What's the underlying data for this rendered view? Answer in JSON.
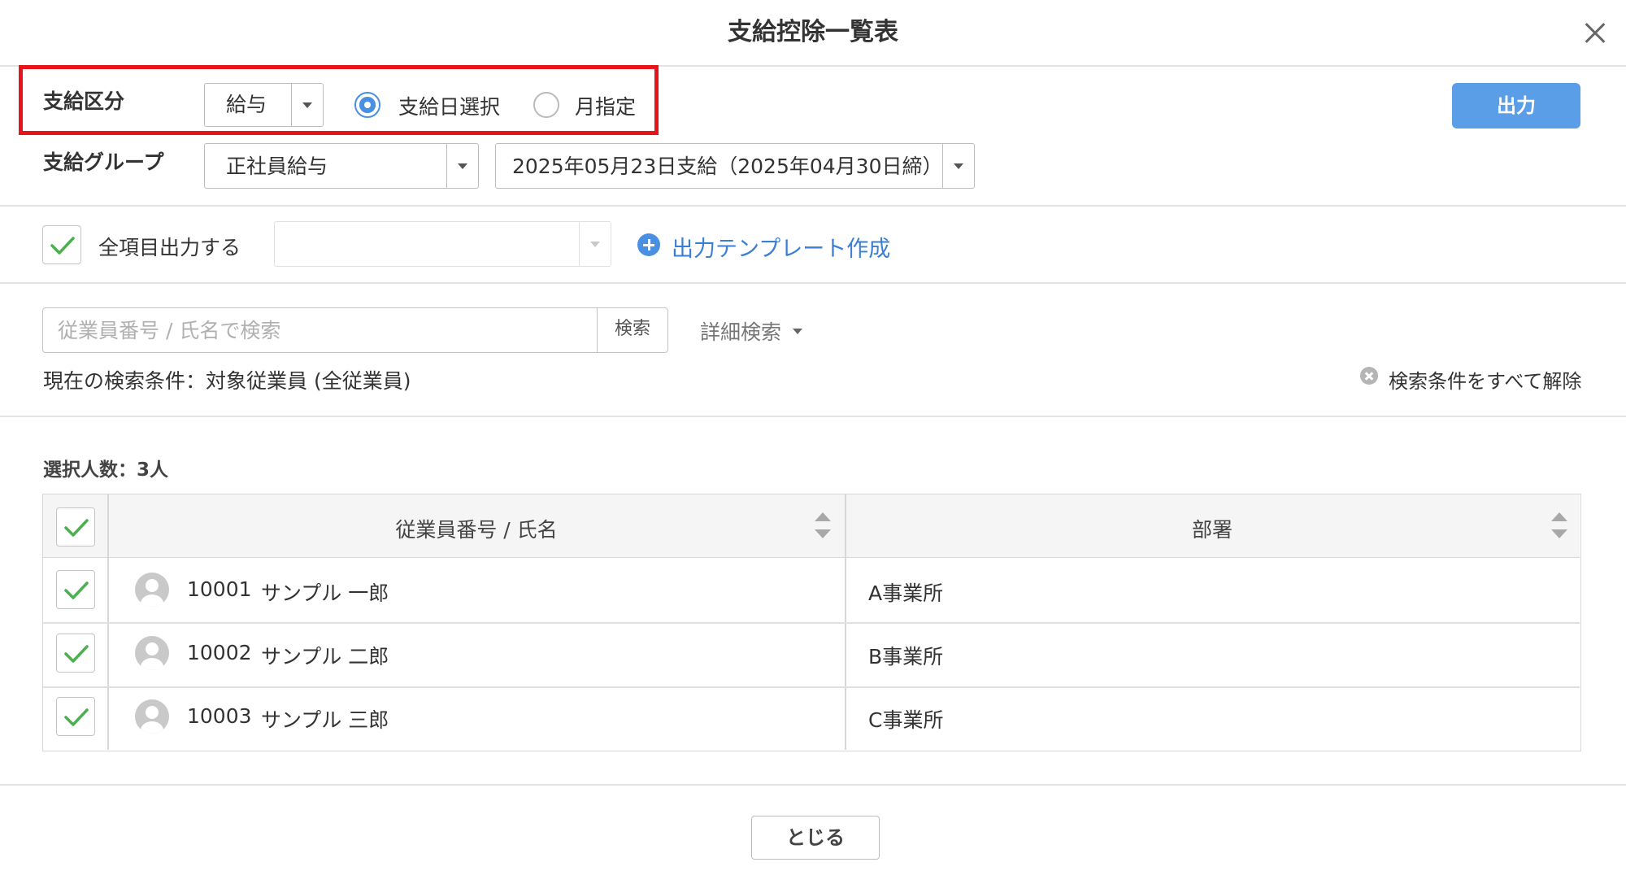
{
  "dialog": {
    "title": "支給控除一覧表"
  },
  "pay_category": {
    "label": "支給区分",
    "select_value": "給与",
    "radio_options": [
      {
        "label": "支給日選択",
        "selected": true
      },
      {
        "label": "月指定",
        "selected": false
      }
    ]
  },
  "pay_group": {
    "label": "支給グループ",
    "group_value": "正社員給与",
    "date_value": "2025年05月23日支給（2025年04月30日締）"
  },
  "output_button": {
    "label": "出力"
  },
  "all_items": {
    "label": "全項目出力する",
    "checked": true,
    "template_select_value": "",
    "create_template_link": "出力テンプレート作成"
  },
  "search": {
    "placeholder": "従業員番号 / 氏名で検索",
    "button_label": "検索",
    "advanced_label": "詳細検索",
    "current_conditions": "現在の検索条件：対象従業員 (全従業員)",
    "clear_all_label": "検索条件をすべて解除"
  },
  "selection_count": "選択人数：3人",
  "table": {
    "columns": [
      "従業員番号 / 氏名",
      "部署"
    ],
    "rows": [
      {
        "id": "10001",
        "name": "サンプル 一郎",
        "department": "A事業所",
        "checked": true
      },
      {
        "id": "10002",
        "name": "サンプル 二郎",
        "department": "B事業所",
        "checked": true
      },
      {
        "id": "10003",
        "name": "サンプル 三郎",
        "department": "C事業所",
        "checked": true
      }
    ]
  },
  "footer": {
    "close_label": "とじる"
  },
  "colors": {
    "accent": "#5b9ee8",
    "highlight": "#e8141b",
    "check": "#4caf50",
    "link": "#3a7fd5"
  }
}
